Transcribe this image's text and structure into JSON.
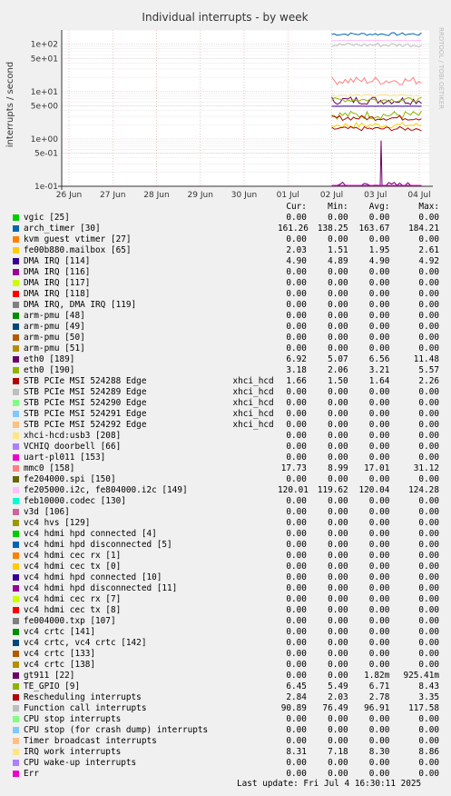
{
  "chart_data": {
    "type": "line",
    "title": "Individual interrupts - by week",
    "ylabel": "interrupts / second",
    "side_label": "RRDTOOL / TOBI OETIKER",
    "yscale": "log",
    "ylim": [
      0.1,
      200
    ],
    "y_ticks": [
      "1e-01",
      "5e-01",
      "1e+00",
      "5e+00",
      "1e+01",
      "5e+01",
      "1e+02"
    ],
    "x_ticks": [
      "26 Jun",
      "27 Jun",
      "28 Jun",
      "29 Jun",
      "30 Jun",
      "01 Jul",
      "02 Jul",
      "03 Jul",
      "04 Jul"
    ],
    "data_start": "02 Jul",
    "series": [
      {
        "name": "vgic [25]",
        "color": "#00cc00",
        "cur": "0.00",
        "min": "0.00",
        "avg": "0.00",
        "max": "0.00"
      },
      {
        "name": "arch_timer [30]",
        "color": "#0066b3",
        "cur": "161.26",
        "min": "138.25",
        "avg": "163.67",
        "max": "184.21"
      },
      {
        "name": "kvm guest vtimer [27]",
        "color": "#ff8000",
        "cur": "0.00",
        "min": "0.00",
        "avg": "0.00",
        "max": "0.00"
      },
      {
        "name": "fe00b880.mailbox [65]",
        "color": "#ffcc00",
        "cur": "2.03",
        "min": "1.51",
        "avg": "1.95",
        "max": "2.61"
      },
      {
        "name": "DMA IRQ [114]",
        "color": "#330099",
        "cur": "4.90",
        "min": "4.89",
        "avg": "4.90",
        "max": "4.92"
      },
      {
        "name": "DMA IRQ [116]",
        "color": "#990099",
        "cur": "0.00",
        "min": "0.00",
        "avg": "0.00",
        "max": "0.00"
      },
      {
        "name": "DMA IRQ [117]",
        "color": "#ccff00",
        "cur": "0.00",
        "min": "0.00",
        "avg": "0.00",
        "max": "0.00"
      },
      {
        "name": "DMA IRQ [118]",
        "color": "#ff0000",
        "cur": "0.00",
        "min": "0.00",
        "avg": "0.00",
        "max": "0.00"
      },
      {
        "name": "DMA IRQ, DMA IRQ [119]",
        "color": "#808080",
        "cur": "0.00",
        "min": "0.00",
        "avg": "0.00",
        "max": "0.00"
      },
      {
        "name": "arm-pmu [48]",
        "color": "#008f00",
        "cur": "0.00",
        "min": "0.00",
        "avg": "0.00",
        "max": "0.00"
      },
      {
        "name": "arm-pmu [49]",
        "color": "#00487d",
        "cur": "0.00",
        "min": "0.00",
        "avg": "0.00",
        "max": "0.00"
      },
      {
        "name": "arm-pmu [50]",
        "color": "#b35a00",
        "cur": "0.00",
        "min": "0.00",
        "avg": "0.00",
        "max": "0.00"
      },
      {
        "name": "arm-pmu [51]",
        "color": "#b38f00",
        "cur": "0.00",
        "min": "0.00",
        "avg": "0.00",
        "max": "0.00"
      },
      {
        "name": "eth0 [189]",
        "color": "#6b006b",
        "cur": "6.92",
        "min": "5.07",
        "avg": "6.56",
        "max": "11.48"
      },
      {
        "name": "eth0 [190]",
        "color": "#8fb300",
        "cur": "3.18",
        "min": "2.06",
        "avg": "3.21",
        "max": "5.57"
      },
      {
        "name": "STB PCIe MSI 524288 Edge",
        "device": "xhci_hcd",
        "color": "#b30000",
        "cur": "1.66",
        "min": "1.50",
        "avg": "1.64",
        "max": "2.26"
      },
      {
        "name": "STB PCIe MSI 524289 Edge",
        "device": "xhci_hcd",
        "color": "#bebebe",
        "cur": "0.00",
        "min": "0.00",
        "avg": "0.00",
        "max": "0.00"
      },
      {
        "name": "STB PCIe MSI 524290 Edge",
        "device": "xhci_hcd",
        "color": "#80ff80",
        "cur": "0.00",
        "min": "0.00",
        "avg": "0.00",
        "max": "0.00"
      },
      {
        "name": "STB PCIe MSI 524291 Edge",
        "device": "xhci_hcd",
        "color": "#80c9ff",
        "cur": "0.00",
        "min": "0.00",
        "avg": "0.00",
        "max": "0.00"
      },
      {
        "name": "STB PCIe MSI 524292 Edge",
        "device": "xhci_hcd",
        "color": "#ffc080",
        "cur": "0.00",
        "min": "0.00",
        "avg": "0.00",
        "max": "0.00"
      },
      {
        "name": "xhci-hcd:usb3 [208]",
        "color": "#ffe680",
        "cur": "0.00",
        "min": "0.00",
        "avg": "0.00",
        "max": "0.00"
      },
      {
        "name": "VCHIQ doorbell [66]",
        "color": "#aa80ff",
        "cur": "0.00",
        "min": "0.00",
        "avg": "0.00",
        "max": "0.00"
      },
      {
        "name": "uart-pl011 [153]",
        "color": "#ee00cc",
        "cur": "0.00",
        "min": "0.00",
        "avg": "0.00",
        "max": "0.00"
      },
      {
        "name": "mmc0 [158]",
        "color": "#ff8080",
        "cur": "17.73",
        "min": "8.99",
        "avg": "17.01",
        "max": "31.12"
      },
      {
        "name": "fe204000.spi [150]",
        "color": "#666600",
        "cur": "0.00",
        "min": "0.00",
        "avg": "0.00",
        "max": "0.00"
      },
      {
        "name": "fe205000.i2c, fe804000.i2c [149]",
        "color": "#ffbfff",
        "cur": "120.01",
        "min": "119.62",
        "avg": "120.04",
        "max": "124.28"
      },
      {
        "name": "feb10000.codec [130]",
        "color": "#00ffcc",
        "cur": "0.00",
        "min": "0.00",
        "avg": "0.00",
        "max": "0.00"
      },
      {
        "name": "v3d [106]",
        "color": "#cc6699",
        "cur": "0.00",
        "min": "0.00",
        "avg": "0.00",
        "max": "0.00"
      },
      {
        "name": "vc4 hvs [129]",
        "color": "#999900",
        "cur": "0.00",
        "min": "0.00",
        "avg": "0.00",
        "max": "0.00"
      },
      {
        "name": "vc4 hdmi hpd connected [4]",
        "color": "#00cc00",
        "cur": "0.00",
        "min": "0.00",
        "avg": "0.00",
        "max": "0.00"
      },
      {
        "name": "vc4 hdmi hpd disconnected [5]",
        "color": "#0066b3",
        "cur": "0.00",
        "min": "0.00",
        "avg": "0.00",
        "max": "0.00"
      },
      {
        "name": "vc4 hdmi cec rx [1]",
        "color": "#ff8000",
        "cur": "0.00",
        "min": "0.00",
        "avg": "0.00",
        "max": "0.00"
      },
      {
        "name": "vc4 hdmi cec tx [0]",
        "color": "#ffcc00",
        "cur": "0.00",
        "min": "0.00",
        "avg": "0.00",
        "max": "0.00"
      },
      {
        "name": "vc4 hdmi hpd connected [10]",
        "color": "#330099",
        "cur": "0.00",
        "min": "0.00",
        "avg": "0.00",
        "max": "0.00"
      },
      {
        "name": "vc4 hdmi hpd disconnected [11]",
        "color": "#990099",
        "cur": "0.00",
        "min": "0.00",
        "avg": "0.00",
        "max": "0.00"
      },
      {
        "name": "vc4 hdmi cec rx [7]",
        "color": "#ccff00",
        "cur": "0.00",
        "min": "0.00",
        "avg": "0.00",
        "max": "0.00"
      },
      {
        "name": "vc4 hdmi cec tx [8]",
        "color": "#ff0000",
        "cur": "0.00",
        "min": "0.00",
        "avg": "0.00",
        "max": "0.00"
      },
      {
        "name": "fe004000.txp [107]",
        "color": "#808080",
        "cur": "0.00",
        "min": "0.00",
        "avg": "0.00",
        "max": "0.00"
      },
      {
        "name": "vc4 crtc [141]",
        "color": "#008f00",
        "cur": "0.00",
        "min": "0.00",
        "avg": "0.00",
        "max": "0.00"
      },
      {
        "name": "vc4 crtc, vc4 crtc [142]",
        "color": "#00487d",
        "cur": "0.00",
        "min": "0.00",
        "avg": "0.00",
        "max": "0.00"
      },
      {
        "name": "vc4 crtc [133]",
        "color": "#b35a00",
        "cur": "0.00",
        "min": "0.00",
        "avg": "0.00",
        "max": "0.00"
      },
      {
        "name": "vc4 crtc [138]",
        "color": "#b38f00",
        "cur": "0.00",
        "min": "0.00",
        "avg": "0.00",
        "max": "0.00"
      },
      {
        "name": "gt911 [22]",
        "color": "#6b006b",
        "cur": "0.00",
        "min": "0.00",
        "avg": "1.82m",
        "max": "925.41m"
      },
      {
        "name": "TE_GPIO [9]",
        "color": "#8fb300",
        "cur": "6.45",
        "min": "5.49",
        "avg": "6.71",
        "max": "8.43"
      },
      {
        "name": "Rescheduling interrupts",
        "color": "#b30000",
        "cur": "2.84",
        "min": "2.03",
        "avg": "2.78",
        "max": "3.35"
      },
      {
        "name": "Function call interrupts",
        "color": "#bebebe",
        "cur": "90.89",
        "min": "76.49",
        "avg": "96.91",
        "max": "117.58"
      },
      {
        "name": "CPU stop interrupts",
        "color": "#80ff80",
        "cur": "0.00",
        "min": "0.00",
        "avg": "0.00",
        "max": "0.00"
      },
      {
        "name": "CPU stop (for crash dump) interrupts",
        "color": "#80c9ff",
        "cur": "0.00",
        "min": "0.00",
        "avg": "0.00",
        "max": "0.00"
      },
      {
        "name": "Timer broadcast interrupts",
        "color": "#ffc080",
        "cur": "0.00",
        "min": "0.00",
        "avg": "0.00",
        "max": "0.00"
      },
      {
        "name": "IRQ work interrupts",
        "color": "#ffe680",
        "cur": "8.31",
        "min": "7.18",
        "avg": "8.30",
        "max": "8.86"
      },
      {
        "name": "CPU wake-up interrupts",
        "color": "#aa80ff",
        "cur": "0.00",
        "min": "0.00",
        "avg": "0.00",
        "max": "0.00"
      },
      {
        "name": "Err",
        "color": "#ee00cc",
        "cur": "0.00",
        "min": "0.00",
        "avg": "0.00",
        "max": "0.00"
      }
    ]
  },
  "legend": {
    "headers": {
      "cur": "Cur:",
      "min": "Min:",
      "avg": "Avg:",
      "max": "Max:"
    },
    "last_update": "Last update: Fri Jul  4 16:30:11 2025"
  }
}
